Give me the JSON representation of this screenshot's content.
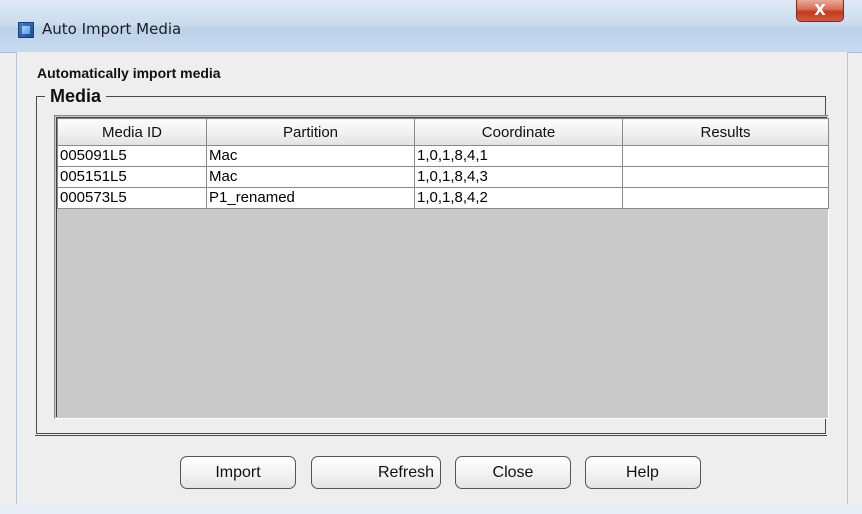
{
  "window": {
    "title": "Auto Import Media",
    "close_label": "X"
  },
  "main": {
    "heading": "Automatically import media",
    "group_label": "Media"
  },
  "table": {
    "columns": [
      "Media ID",
      "Partition",
      "Coordinate",
      "Results"
    ],
    "rows": [
      [
        "005091L5",
        "Mac",
        "1,0,1,8,4,1",
        ""
      ],
      [
        "005151L5",
        "Mac",
        "1,0,1,8,4,3",
        ""
      ],
      [
        "000573L5",
        "P1_renamed",
        "1,0,1,8,4,2",
        ""
      ]
    ]
  },
  "buttons": {
    "import": "Import",
    "refresh": "Refresh",
    "close": "Close",
    "help": "Help"
  },
  "icons": {
    "app": "app-window-icon"
  }
}
